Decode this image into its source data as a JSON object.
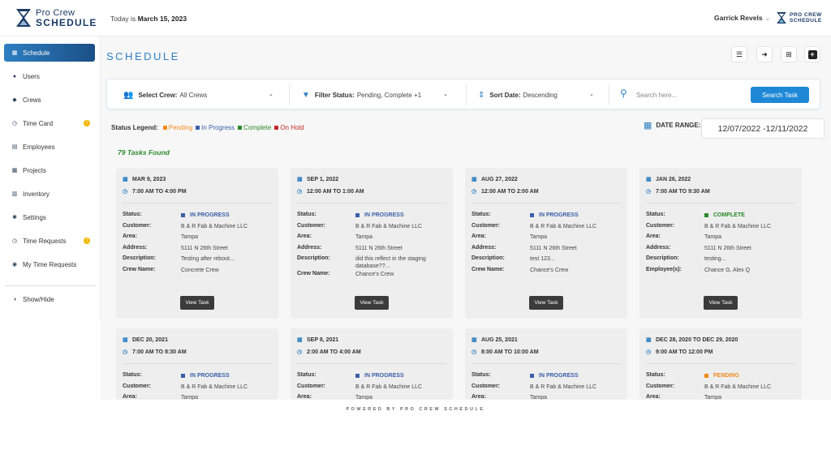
{
  "app": {
    "logo_top": "Pro Crew",
    "logo_bottom": "SCHEDULE",
    "small_logo_top": "PRO CREW",
    "small_logo_bottom": "SCHEDULE",
    "today_prefix": "Today is",
    "today_date": "March 15, 2023",
    "user_name": "Garrick Revels"
  },
  "sidebar": {
    "items": [
      {
        "label": "Schedule",
        "icon": "calendar-icon",
        "glyph": "▦",
        "badge": false
      },
      {
        "label": "Users",
        "icon": "user-icon",
        "glyph": "●",
        "badge": false
      },
      {
        "label": "Crews",
        "icon": "users-icon",
        "glyph": "◆",
        "badge": false
      },
      {
        "label": "Time Card",
        "icon": "clock-icon",
        "glyph": "◷",
        "badge": true
      },
      {
        "label": "Employees",
        "icon": "id-card-icon",
        "glyph": "▤",
        "badge": false
      },
      {
        "label": "Projects",
        "icon": "grid-icon",
        "glyph": "▦",
        "badge": false
      },
      {
        "label": "Inventory",
        "icon": "inventory-icon",
        "glyph": "▥",
        "badge": false
      },
      {
        "label": "Settings",
        "icon": "gear-icon",
        "glyph": "✱",
        "badge": false
      },
      {
        "label": "Time Requests",
        "icon": "clock-icon",
        "glyph": "◷",
        "badge": true
      },
      {
        "label": "My Time Requests",
        "icon": "user-circle-icon",
        "glyph": "◉",
        "badge": false
      }
    ],
    "badge_text": "!",
    "show_hide": "Show/Hide"
  },
  "main": {
    "title": "SCHEDULE",
    "filters": {
      "crew_label": "Select Crew:",
      "crew_value": "All Crews",
      "status_label": "Filter Status:",
      "status_value": "Pending, Complete +1",
      "sort_label": "Sort Date:",
      "sort_value": "Descending",
      "search_placeholder": "Search here...",
      "search_button": "Search Task"
    },
    "legend": {
      "label": "Status Legend:",
      "items": [
        {
          "label": "Pending",
          "color": "#f08a1c"
        },
        {
          "label": "In Progress",
          "color": "#3a5fa8"
        },
        {
          "label": "Complete",
          "color": "#2a8a2a"
        },
        {
          "label": "On Hold",
          "color": "#c62828"
        }
      ]
    },
    "date_range_label": "DATE RANGE:",
    "date_range_value": "12/07/2022 -12/11/2022",
    "tasks_found": "79 Tasks Found",
    "view_button": "View Task"
  },
  "labels": {
    "status": "Status:",
    "customer": "Customer:",
    "area": "Area:",
    "address": "Address:",
    "description": "Description:",
    "crew_name": "Crew Name:",
    "employees": "Employee(s):"
  },
  "cards": [
    {
      "date": "MAR 9, 2023",
      "time": "7:00 AM TO 4:00 PM",
      "status": "IN PROGRESS",
      "status_color": "#3a5fa8",
      "customer": "B & R Fab & Machine LLC",
      "area": "Tampa",
      "address": "5111 N 26th Street",
      "description": "Testing after reboot...",
      "assign_label": "Crew Name:",
      "assign_value": "Concrete Crew"
    },
    {
      "date": "SEP 1, 2022",
      "time": "12:00 AM TO 1:00 AM",
      "status": "IN PROGRESS",
      "status_color": "#3a5fa8",
      "customer": "B & R Fab & Machine LLC",
      "area": "Tampa",
      "address": "5111 N 26th Street",
      "description": "did this reflect in the staging database??...",
      "assign_label": "Crew Name:",
      "assign_value": "Chance's Crew"
    },
    {
      "date": "AUG 27, 2022",
      "time": "12:00 AM TO 2:00 AM",
      "status": "IN PROGRESS",
      "status_color": "#3a5fa8",
      "customer": "B & R Fab & Machine LLC",
      "area": "Tampa",
      "address": "5111 N 26th Street",
      "description": "test 123...",
      "assign_label": "Crew Name:",
      "assign_value": "Chance's Crew"
    },
    {
      "date": "JAN 26, 2022",
      "time": "7:00 AM TO 9:30 AM",
      "status": "COMPLETE",
      "status_color": "#2a8a2a",
      "customer": "B & R Fab & Machine LLC",
      "area": "Tampa",
      "address": "5111 N 26th Street",
      "description": "testing...",
      "assign_label": "Employee(s):",
      "assign_value": "Chance G, Alex Q"
    },
    {
      "date": "DEC 20, 2021",
      "time": "7:00 AM TO 8:30 AM",
      "status": "IN PROGRESS",
      "status_color": "#3a5fa8",
      "customer": "B & R Fab & Machine LLC",
      "area": "Tampa"
    },
    {
      "date": "SEP 8, 2021",
      "time": "2:00 AM TO 4:00 AM",
      "status": "IN PROGRESS",
      "status_color": "#3a5fa8",
      "customer": "B & R Fab & Machine LLC",
      "area": "Tampa"
    },
    {
      "date": "AUG 25, 2021",
      "time": "8:00 AM TO 10:00 AM",
      "status": "IN PROGRESS",
      "status_color": "#3a5fa8",
      "customer": "B & R Fab & Machine LLC",
      "area": "Tampa"
    },
    {
      "date": "DEC 28, 2020 TO DEC 29, 2020",
      "time": "9:00 AM TO 12:00 PM",
      "status": "PENDING",
      "status_color": "#f08a1c",
      "customer": "B & R Fab & Machine LLC",
      "area": "Tampa"
    }
  ],
  "footer": "POWERED BY PRO CREW SCHEDULE"
}
